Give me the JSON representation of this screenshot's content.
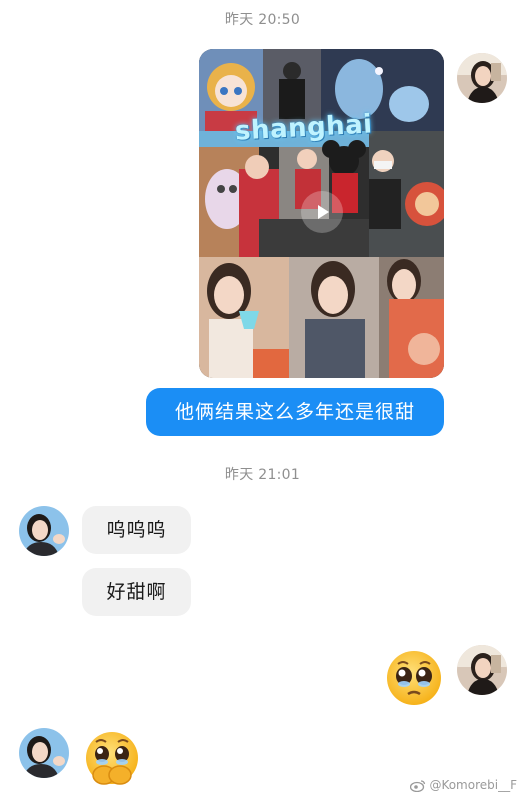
{
  "chat": {
    "timestamps": [
      "昨天 20:50",
      "昨天 21:01"
    ],
    "media": {
      "title_text": "shanghai"
    },
    "messages": {
      "sent_text": "他俩结果这么多年还是很甜",
      "received_1": "呜呜呜",
      "received_2": "好甜啊"
    },
    "emojis": {
      "sent": "pleading-face-icon",
      "received": "hands-over-mouth-crying-icon"
    }
  },
  "watermark": {
    "text": "@Komorebi__F"
  },
  "colors": {
    "sent_bubble": "#1b8ef5",
    "received_bubble": "#f1f1f1",
    "timestamp": "#8f8f8f",
    "background": "#ffffff"
  }
}
